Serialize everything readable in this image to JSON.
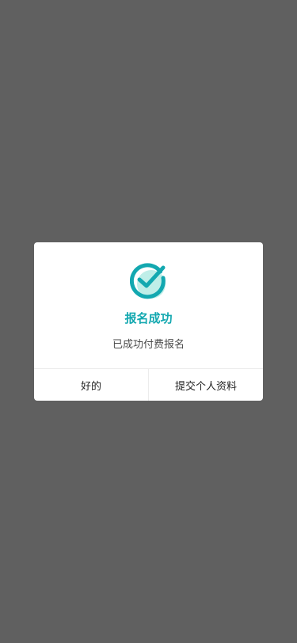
{
  "dialog": {
    "icon": "check-circle-icon",
    "title": "报名成功",
    "message": "已成功付费报名",
    "buttons": {
      "ok_label": "好的",
      "submit_label": "提交个人资料"
    }
  },
  "colors": {
    "accent": "#13a8b0",
    "accent_light": "#bfeee8",
    "overlay": "#606060"
  }
}
